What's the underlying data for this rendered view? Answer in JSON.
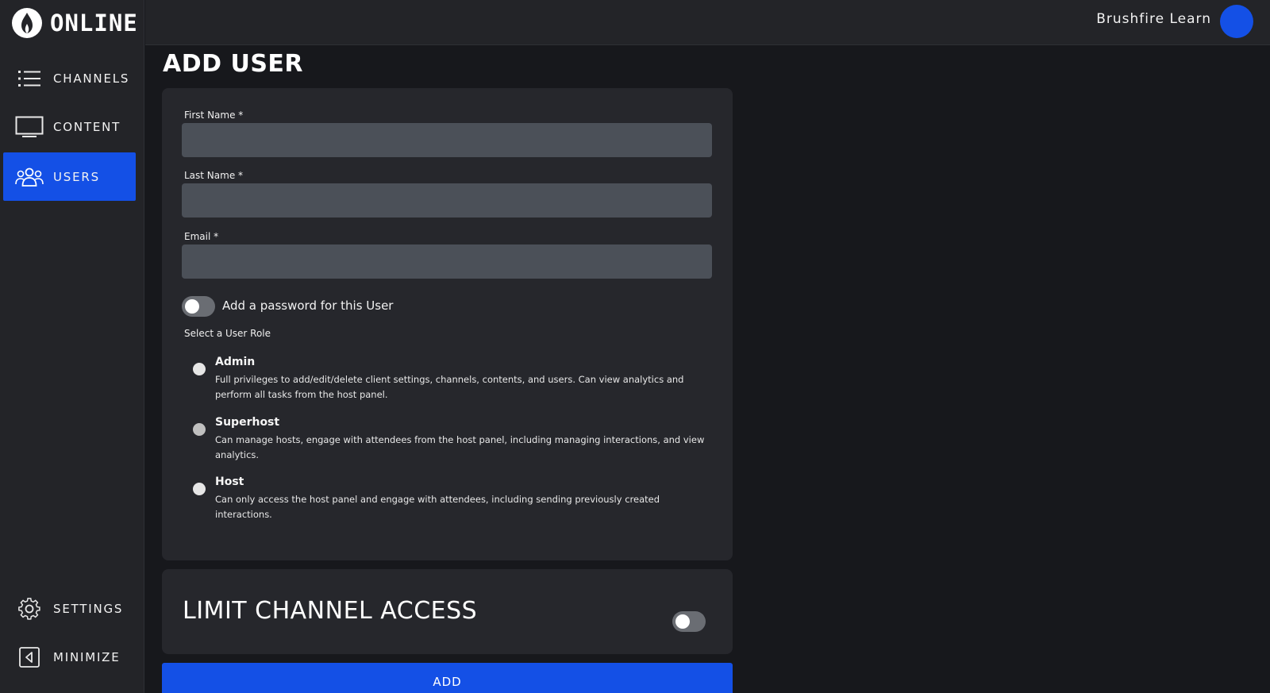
{
  "brand": {
    "logo_text": "ONLINE"
  },
  "sidebar": {
    "items": [
      {
        "label": "CHANNELS",
        "icon": "list-icon",
        "active": false
      },
      {
        "label": "CONTENT",
        "icon": "monitor-icon",
        "active": false
      },
      {
        "label": "USERS",
        "icon": "users-icon",
        "active": true
      }
    ],
    "bottom_items": [
      {
        "label": "SETTINGS",
        "icon": "gear-icon"
      },
      {
        "label": "MINIMIZE",
        "icon": "collapse-icon"
      }
    ]
  },
  "header": {
    "account_name": "Brushfire Learn"
  },
  "page": {
    "title": "ADD USER"
  },
  "form": {
    "first_name": {
      "label": "First Name *",
      "value": ""
    },
    "last_name": {
      "label": "Last Name *",
      "value": ""
    },
    "email": {
      "label": "Email *",
      "value": ""
    },
    "password_toggle": {
      "label": "Add a password for this User",
      "checked": false
    },
    "role_heading": "Select a User Role",
    "roles": [
      {
        "title": "Admin",
        "description": "Full privileges to add/edit/delete client settings, channels, contents, and users. Can view analytics and perform all tasks from the host panel."
      },
      {
        "title": "Superhost",
        "description": "Can manage hosts, engage with attendees from the host panel, including managing interactions, and view analytics."
      },
      {
        "title": "Host",
        "description": "Can only access the host panel and engage with attendees, including sending previously created interactions."
      }
    ]
  },
  "limit_access": {
    "title": "LIMIT CHANNEL ACCESS",
    "checked": false
  },
  "actions": {
    "add_label": "ADD"
  },
  "colors": {
    "accent": "#1450e6",
    "background": "#17181c",
    "panel": "#26272c",
    "input": "#4b5058"
  }
}
